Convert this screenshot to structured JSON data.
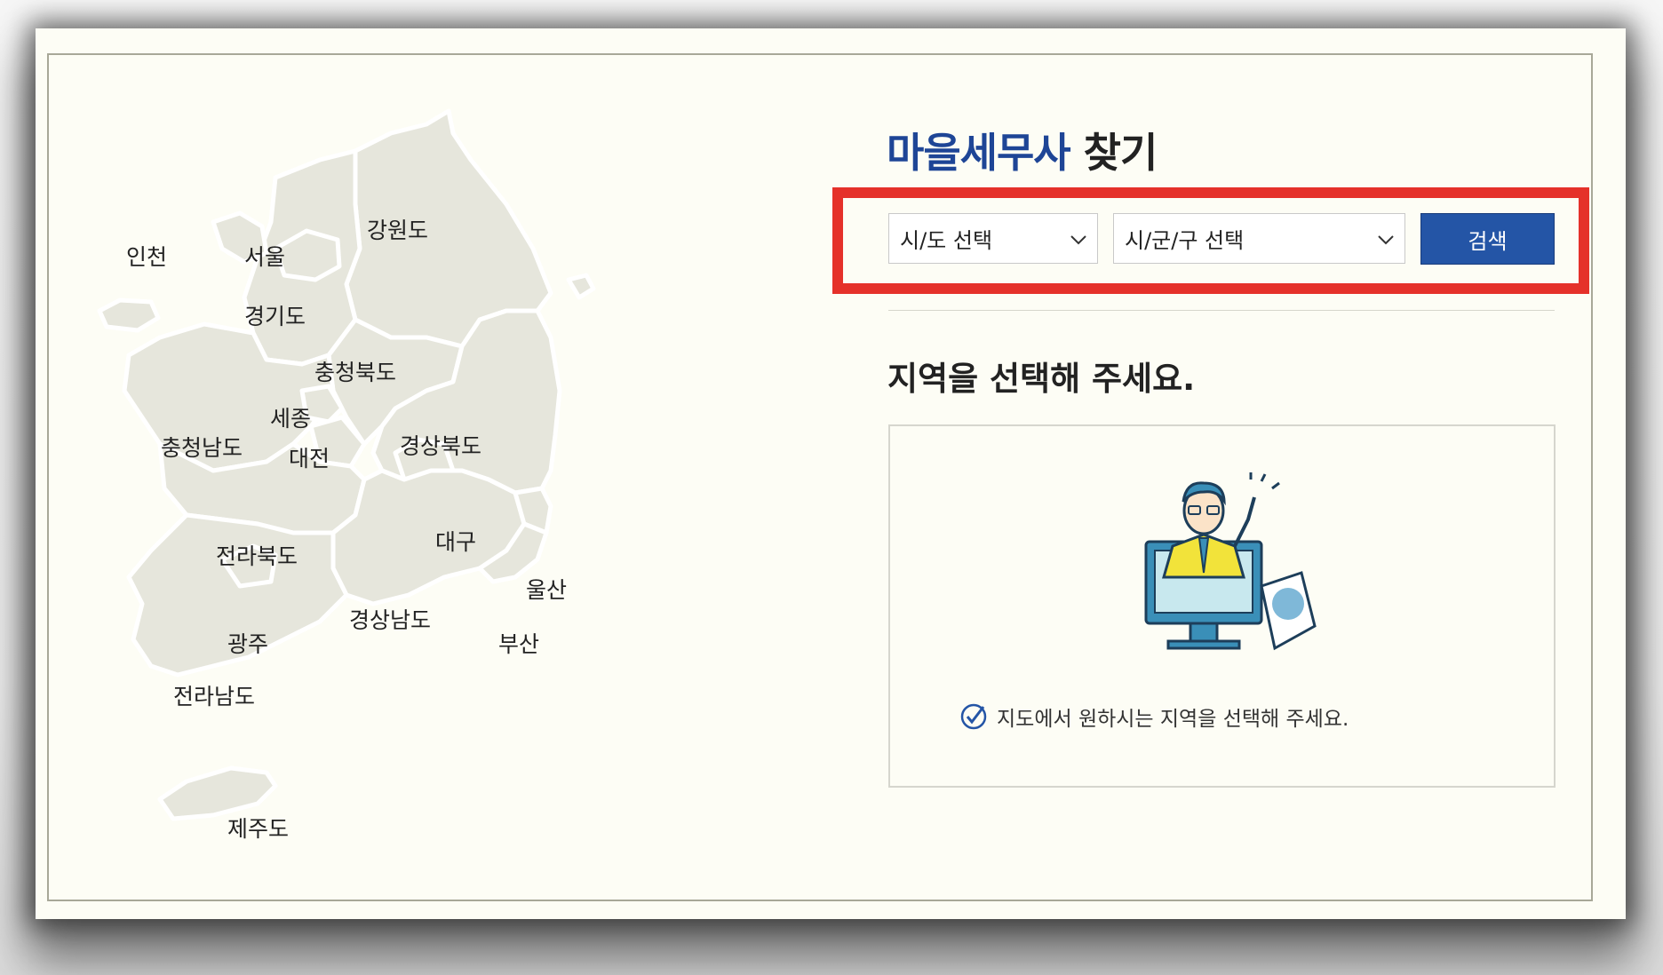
{
  "title": {
    "highlight": "마을세무사",
    "rest": " 찾기"
  },
  "search": {
    "province_select": "시/도 선택",
    "district_select": "시/군/구 선택",
    "button_label": "검색"
  },
  "prompt_heading": "지역을 선택해 주세요.",
  "hint_text": "지도에서 원하시는 지역을 선택해 주세요.",
  "map_regions": {
    "incheon": "인천",
    "seoul": "서울",
    "gangwon": "강원도",
    "gyeonggi": "경기도",
    "chungbuk": "충청북도",
    "sejong": "세종",
    "chungnam": "충청남도",
    "daejeon": "대전",
    "gyeongbuk": "경상북도",
    "daegu": "대구",
    "jeonbuk": "전라북도",
    "ulsan": "울산",
    "gyeongnam": "경상남도",
    "gwangju": "광주",
    "busan": "부산",
    "jeonnam": "전라남도",
    "jeju": "제주도"
  },
  "colors": {
    "title_highlight": "#1e4596",
    "search_button": "#2455a6",
    "highlight_box": "#e5312a",
    "map_land": "#e6e6dc",
    "map_border": "#ffffff"
  },
  "icons": {
    "dropdown": "chevron-down-icon",
    "hint": "check-circle-icon"
  }
}
